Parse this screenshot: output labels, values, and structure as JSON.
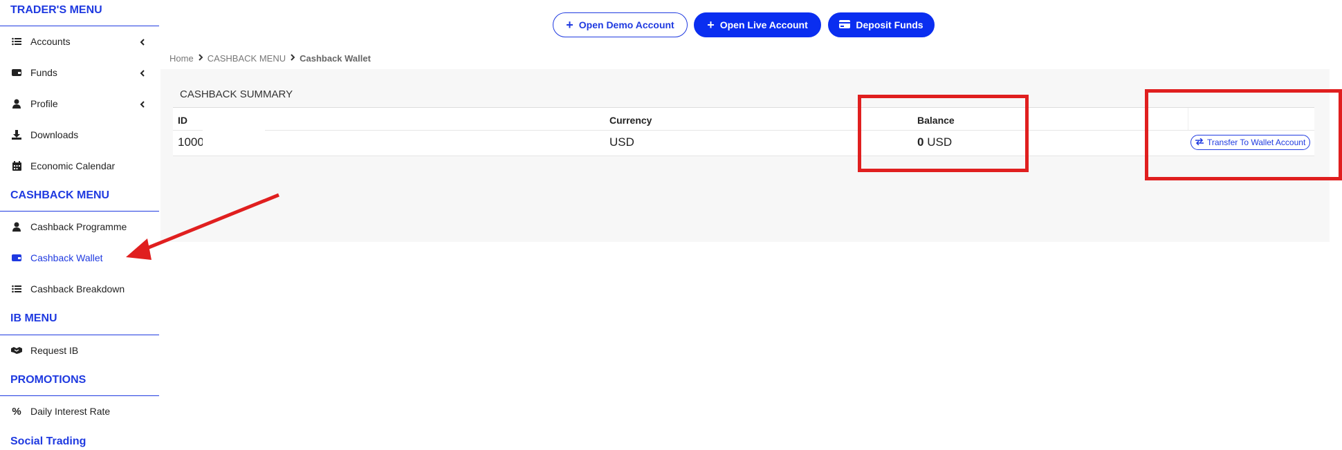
{
  "sidebar": {
    "traders_menu_title": "TRADER'S MENU",
    "traders_items": [
      {
        "label": "Accounts",
        "icon": "list-icon",
        "has_chevron": true
      },
      {
        "label": "Funds",
        "icon": "wallet-icon",
        "has_chevron": true
      },
      {
        "label": "Profile",
        "icon": "user-icon",
        "has_chevron": true
      },
      {
        "label": "Downloads",
        "icon": "download-icon",
        "has_chevron": false
      },
      {
        "label": "Economic Calendar",
        "icon": "calendar-icon",
        "has_chevron": false
      }
    ],
    "cashback_menu_title": "CASHBACK MENU",
    "cashback_items": [
      {
        "label": "Cashback Programme",
        "icon": "user-icon"
      },
      {
        "label": "Cashback Wallet",
        "icon": "wallet-icon",
        "active": true
      },
      {
        "label": "Cashback Breakdown",
        "icon": "list-icon"
      }
    ],
    "ib_menu_title": "IB MENU",
    "ib_items": [
      {
        "label": "Request IB",
        "icon": "handshake-icon"
      }
    ],
    "promotions_title": "PROMOTIONS",
    "promotions_items": [
      {
        "label": "Daily Interest Rate",
        "icon": "percent-icon"
      }
    ],
    "social_trading_title": "Social Trading"
  },
  "header": {
    "open_demo_label": "Open Demo Account",
    "open_live_label": "Open Live Account",
    "deposit_label": "Deposit Funds"
  },
  "breadcrumb": {
    "home": "Home",
    "section": "CASHBACK MENU",
    "current": "Cashback Wallet"
  },
  "main": {
    "summary_title": "CASHBACK SUMMARY",
    "columns": [
      "ID",
      "Currency",
      "Balance",
      ""
    ],
    "row": {
      "id": "1000",
      "currency": "USD",
      "balance_value": "0",
      "balance_currency": "USD",
      "action_label": "Transfer To Wallet Account"
    }
  },
  "colors": {
    "accent": "#1f3ae0",
    "annotation": "#e01f1f"
  }
}
